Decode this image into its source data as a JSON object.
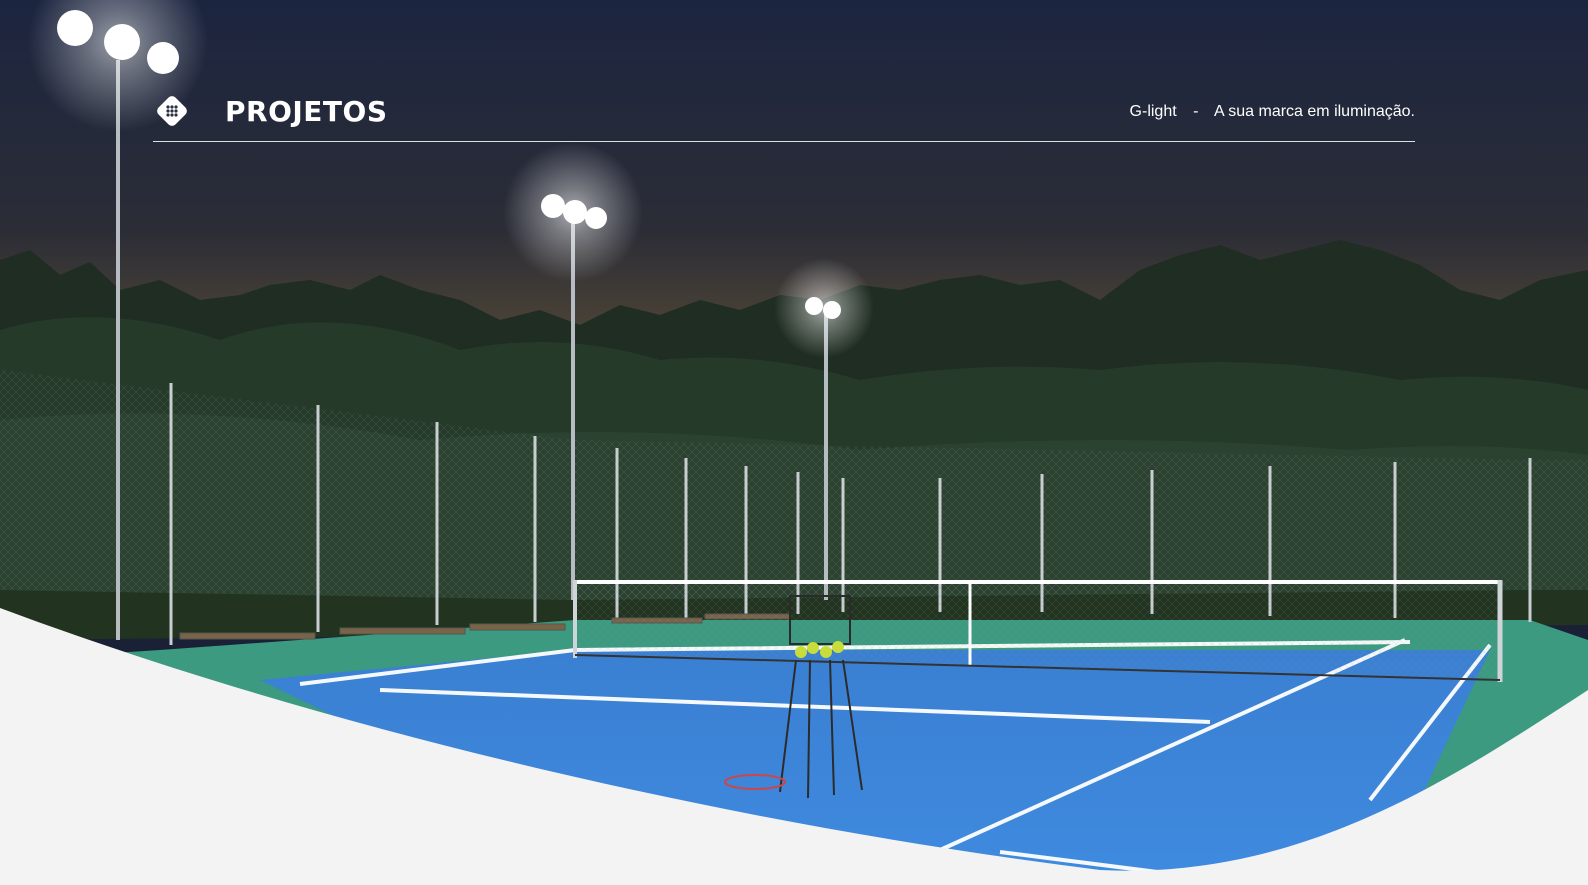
{
  "header": {
    "title": "PROJETOS",
    "brand": "G-light",
    "separator": "-",
    "slogan": "A sua marca em iluminação."
  },
  "icons": {
    "logo": "diamond-dots-icon"
  },
  "colors": {
    "sky_top": "#1b2238",
    "court_blue": "#3d86d8",
    "court_surround": "#3a9a7f",
    "foreground_white": "#f3f3f3"
  }
}
